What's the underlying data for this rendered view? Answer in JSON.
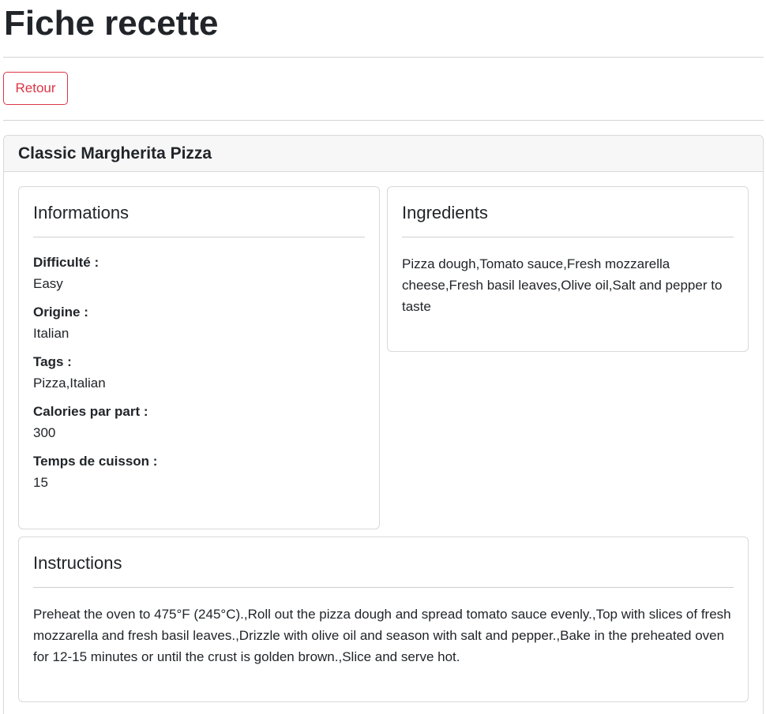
{
  "page": {
    "title": "Fiche recette",
    "back_label": "Retour"
  },
  "recipe": {
    "name": "Classic Margherita Pizza",
    "informations": {
      "title": "Informations",
      "fields": [
        {
          "label": "Difficulté :",
          "value": "Easy"
        },
        {
          "label": "Origine :",
          "value": "Italian"
        },
        {
          "label": "Tags :",
          "value": "Pizza,Italian"
        },
        {
          "label": "Calories par part :",
          "value": "300"
        },
        {
          "label": "Temps de cuisson :",
          "value": "15"
        }
      ]
    },
    "ingredients": {
      "title": "Ingredients",
      "text": "Pizza dough,Tomato sauce,Fresh mozzarella cheese,Fresh basil leaves,Olive oil,Salt and pepper to taste"
    },
    "instructions": {
      "title": "Instructions",
      "text": "Preheat the oven to 475°F (245°C).,Roll out the pizza dough and spread tomato sauce evenly.,Top with slices of fresh mozzarella and fresh basil leaves.,Drizzle with olive oil and season with salt and pepper.,Bake in the preheated oven for 12-15 minutes or until the crust is golden brown.,Slice and serve hot."
    }
  },
  "colors": {
    "danger": "#dc3545",
    "card_header_bg": "#f7f7f7",
    "border": "#d9d9d9"
  }
}
